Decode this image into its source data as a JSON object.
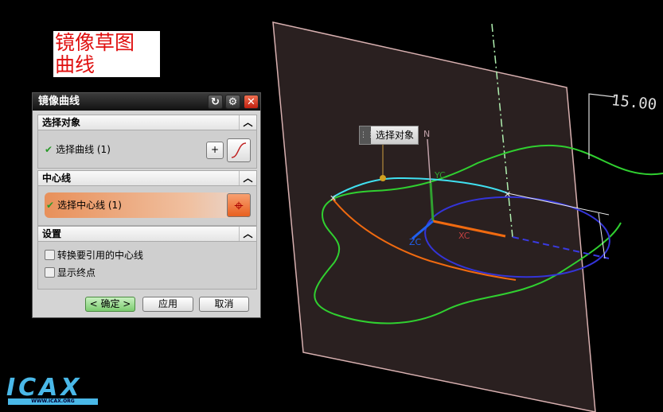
{
  "caption": {
    "line1": "镜像草图",
    "line2": "曲线"
  },
  "dialog": {
    "title": "镜像曲线",
    "reset_icon": "reset-icon",
    "settings_icon": "gear-icon",
    "close_icon": "close-icon",
    "sections": [
      {
        "title": "选择对象",
        "row_label": "选择曲线 (1)"
      },
      {
        "title": "中心线",
        "row_label": "选择中心线 (1)"
      },
      {
        "title": "设置",
        "options": [
          {
            "label": "转换要引用的中心线",
            "checked": false
          },
          {
            "label": "显示终点",
            "checked": false
          }
        ]
      }
    ],
    "buttons": {
      "ok": "< 确定 >",
      "apply": "应用",
      "cancel": "取消"
    }
  },
  "viewport": {
    "tooltip": "选择对象",
    "axis_labels": {
      "n": "N",
      "yc": "YC",
      "xc": "XC",
      "zc": "ZC"
    },
    "dimension": "15.00"
  },
  "logo": {
    "text": "ICAX",
    "url": "WWW.ICAX.ORG"
  },
  "colors": {
    "plane": "#2a2020",
    "curve": "#30d030",
    "mirror": "#f06a10",
    "ellipse": "#3030d0",
    "centerline": "#a0f0a0",
    "accent": "#e8905a"
  }
}
